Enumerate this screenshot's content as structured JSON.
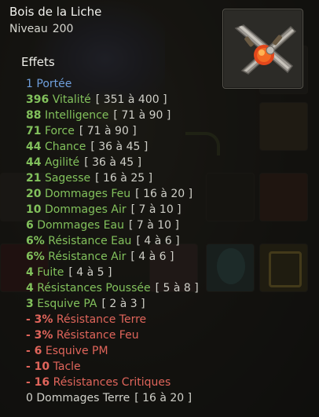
{
  "tooltip": {
    "item_name": "Bois de la Liche",
    "level_label": "Niveau",
    "level_value": "200",
    "item_icon": "crossed-wooden-blade-with-fire-orb-icon",
    "effects_title": "Effets"
  },
  "effects": [
    {
      "value": "1",
      "label": "Portée",
      "range": "",
      "color": "blue"
    },
    {
      "value": "396",
      "label": "Vitalité",
      "range": "[ 351 à 400 ]",
      "color": "green"
    },
    {
      "value": "88",
      "label": "Intelligence",
      "range": "[ 71 à 90 ]",
      "color": "green"
    },
    {
      "value": "71",
      "label": "Force",
      "range": "[ 71 à 90 ]",
      "color": "green"
    },
    {
      "value": "44",
      "label": "Chance",
      "range": "[ 36 à 45 ]",
      "color": "green"
    },
    {
      "value": "44",
      "label": "Agilité",
      "range": "[ 36 à 45 ]",
      "color": "green"
    },
    {
      "value": "21",
      "label": "Sagesse",
      "range": "[ 16 à 25 ]",
      "color": "green"
    },
    {
      "value": "20",
      "label": "Dommages Feu",
      "range": "[ 16 à 20 ]",
      "color": "green"
    },
    {
      "value": "10",
      "label": "Dommages Air",
      "range": "[ 7 à 10 ]",
      "color": "green"
    },
    {
      "value": "6",
      "label": "Dommages Eau",
      "range": "[ 7 à 10 ]",
      "color": "green"
    },
    {
      "value": "6%",
      "label": "Résistance Eau",
      "range": "[ 4 à 6 ]",
      "color": "green"
    },
    {
      "value": "6%",
      "label": "Résistance Air",
      "range": "[ 4 à 6 ]",
      "color": "green"
    },
    {
      "value": "4",
      "label": "Fuite",
      "range": "[ 4 à 5 ]",
      "color": "green"
    },
    {
      "value": "4",
      "label": "Résistances Poussée",
      "range": "[ 5 à 8 ]",
      "color": "green"
    },
    {
      "value": "3",
      "label": "Esquive PA",
      "range": "[ 2 à 3 ]",
      "color": "green"
    },
    {
      "value": "- 3%",
      "label": "Résistance Terre",
      "range": "",
      "color": "red"
    },
    {
      "value": "- 3%",
      "label": "Résistance Feu",
      "range": "",
      "color": "red"
    },
    {
      "value": "- 6",
      "label": "Esquive PM",
      "range": "",
      "color": "red"
    },
    {
      "value": "- 10",
      "label": "Tacle",
      "range": "",
      "color": "red"
    },
    {
      "value": "- 16",
      "label": "Résistances Critiques",
      "range": "",
      "color": "red"
    },
    {
      "value": "0",
      "label": "Dommages Terre",
      "range": "[ 16 à 20 ]",
      "color": "grey"
    }
  ],
  "colors": {
    "positive": "#82c15c",
    "negative": "#e0655b",
    "range_stat": "#6f9fdc",
    "neutral": "#d2d2cb"
  }
}
